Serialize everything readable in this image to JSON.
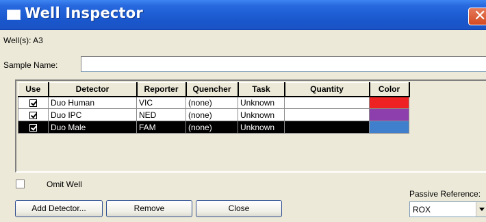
{
  "window": {
    "title": "Well Inspector",
    "close_glyph": "✕"
  },
  "wells": {
    "label": "Well(s): A3"
  },
  "sample": {
    "label": "Sample Name:",
    "value": ""
  },
  "grid": {
    "headers": [
      "Use",
      "Detector",
      "Reporter",
      "Quencher",
      "Task",
      "Quantity",
      "Color"
    ],
    "rows": [
      {
        "use": true,
        "detector": "Duo Human",
        "reporter": "VIC",
        "quencher": "(none)",
        "task": "Unknown",
        "quantity": "",
        "color": "#ee2222",
        "selected": false
      },
      {
        "use": true,
        "detector": "Duo IPC",
        "reporter": "NED",
        "quencher": "(none)",
        "task": "Unknown",
        "quantity": "",
        "color": "#8e3fae",
        "selected": false
      },
      {
        "use": true,
        "detector": "Duo Male",
        "reporter": "FAM",
        "quencher": "(none)",
        "task": "Unknown",
        "quantity": "",
        "color": "#3f7fcc",
        "selected": true
      }
    ]
  },
  "omit": {
    "label": "Omit Well",
    "checked": false
  },
  "buttons": {
    "add_detector": "Add Detector...",
    "remove": "Remove",
    "close": "Close"
  },
  "passive_reference": {
    "label": "Passive Reference:",
    "value": "ROX"
  }
}
